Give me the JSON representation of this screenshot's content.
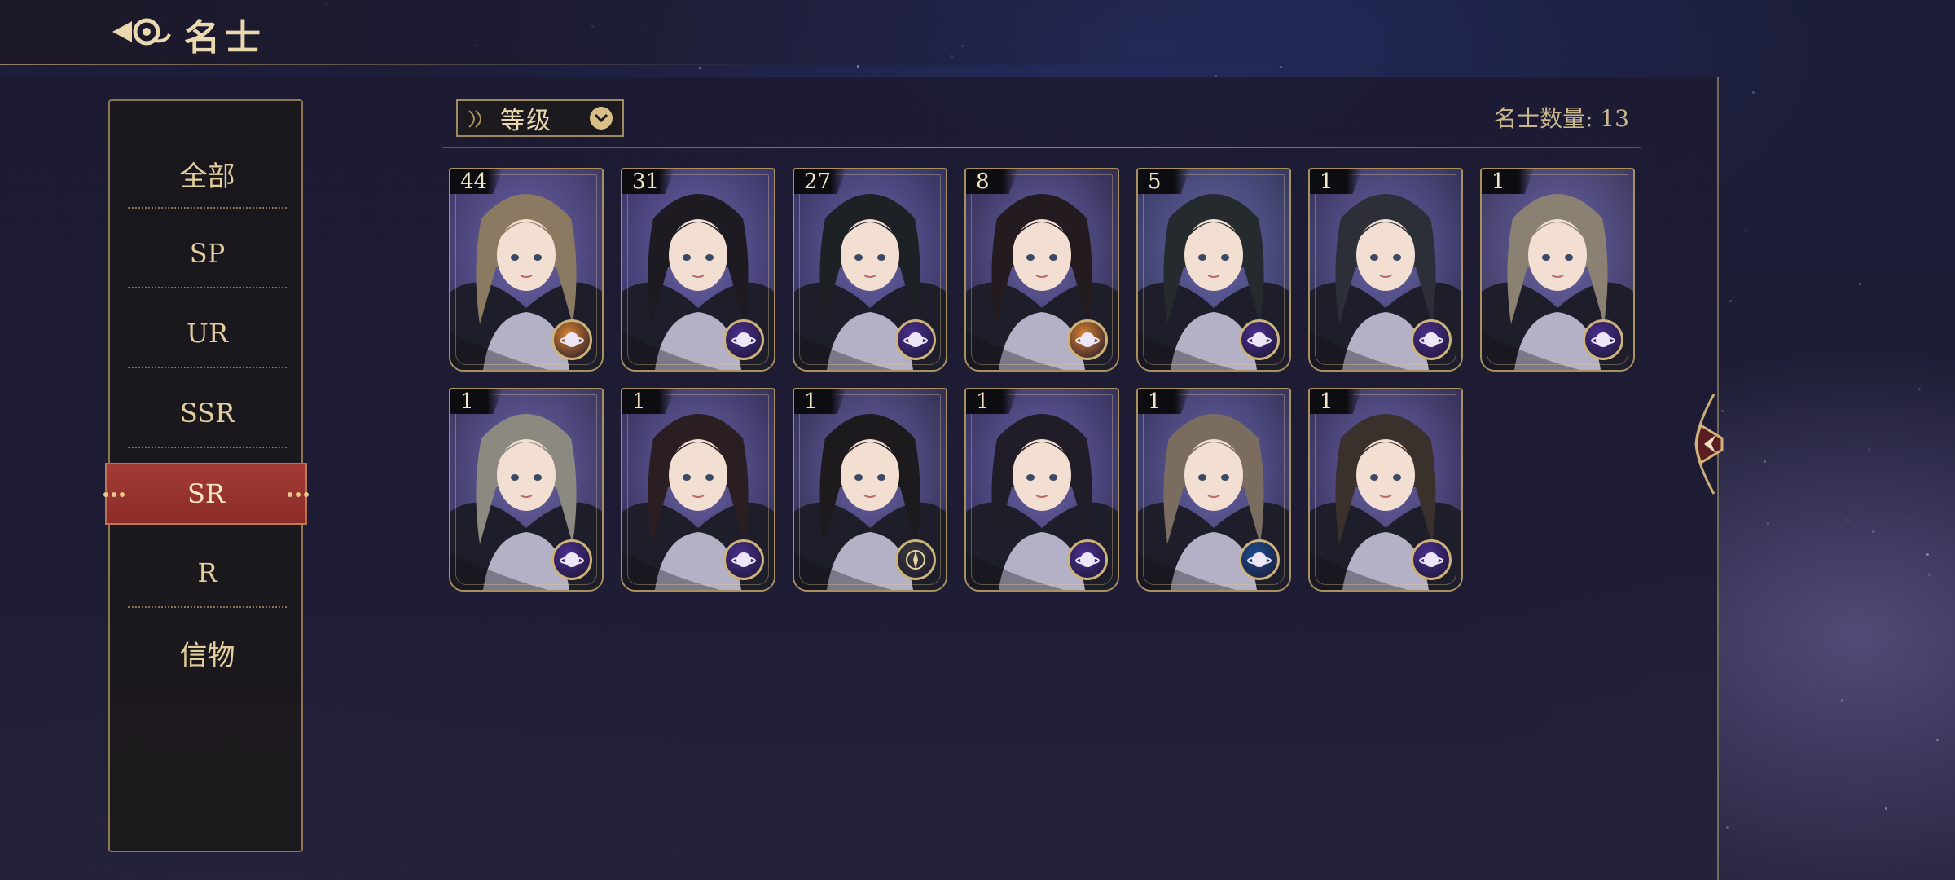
{
  "header": {
    "title": "名士"
  },
  "sidebar": {
    "items": [
      {
        "label": "全部",
        "active": false
      },
      {
        "label": "SP",
        "active": false
      },
      {
        "label": "UR",
        "active": false
      },
      {
        "label": "SSR",
        "active": false
      },
      {
        "label": "SR",
        "active": true
      },
      {
        "label": "R",
        "active": false
      },
      {
        "label": "信物",
        "active": false
      }
    ]
  },
  "sort": {
    "label": "等级"
  },
  "summary": {
    "count_label": "名士数量:",
    "count": "13"
  },
  "colors": {
    "accent_gold": "#d8bf85",
    "active_tab_red": "#9a3430",
    "badge_purple": "#4b2f8f",
    "badge_orange": "#d9832d",
    "badge_blue": "#1d4f8f",
    "badge_gray": "#3a3a3a"
  },
  "cards": [
    {
      "level": "44",
      "badge": "orange-orb-icon"
    },
    {
      "level": "31",
      "badge": "purple-orb-icon"
    },
    {
      "level": "27",
      "badge": "purple-orb-icon"
    },
    {
      "level": "8",
      "badge": "orange-orb-icon"
    },
    {
      "level": "5",
      "badge": "purple-orb-icon"
    },
    {
      "level": "1",
      "badge": "purple-orb-icon"
    },
    {
      "level": "1",
      "badge": "purple-orb-icon"
    },
    {
      "level": "1",
      "badge": "purple-orb-icon"
    },
    {
      "level": "1",
      "badge": "purple-orb-icon"
    },
    {
      "level": "1",
      "badge": "gray-compass-icon"
    },
    {
      "level": "1",
      "badge": "purple-orb-icon"
    },
    {
      "level": "1",
      "badge": "blue-orb-icon"
    },
    {
      "level": "1",
      "badge": "purple-orb-icon"
    }
  ]
}
